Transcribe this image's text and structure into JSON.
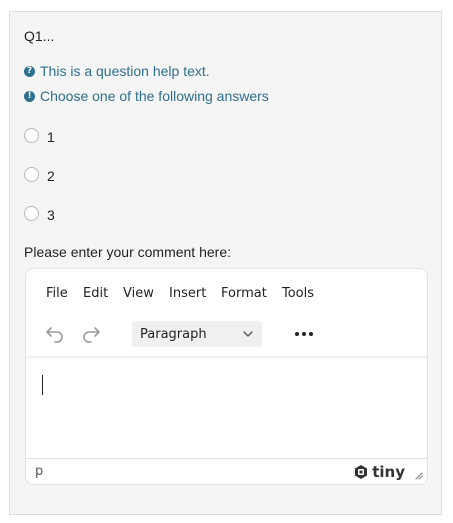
{
  "question": {
    "title": "Q1...",
    "help_text": "This is a question help text.",
    "instruction": "Choose one of the following answers",
    "options": [
      "1",
      "2",
      "3"
    ]
  },
  "comment": {
    "label": "Please enter your comment here:"
  },
  "editor": {
    "menu": [
      "File",
      "Edit",
      "View",
      "Insert",
      "Format",
      "Tools"
    ],
    "block_format": "Paragraph",
    "status_path": "p",
    "brand": "tiny"
  },
  "colors": {
    "accent": "#2e6f8d",
    "card_background": "#f5f5f5"
  },
  "icons": {
    "help": "question-circle-icon",
    "instruction": "exclamation-circle-icon",
    "undo": "undo-icon",
    "redo": "redo-icon",
    "more": "more-horizontal-icon",
    "dropdown": "chevron-down-icon",
    "logo": "tiny-logo-icon",
    "resize": "resize-handle-icon"
  }
}
